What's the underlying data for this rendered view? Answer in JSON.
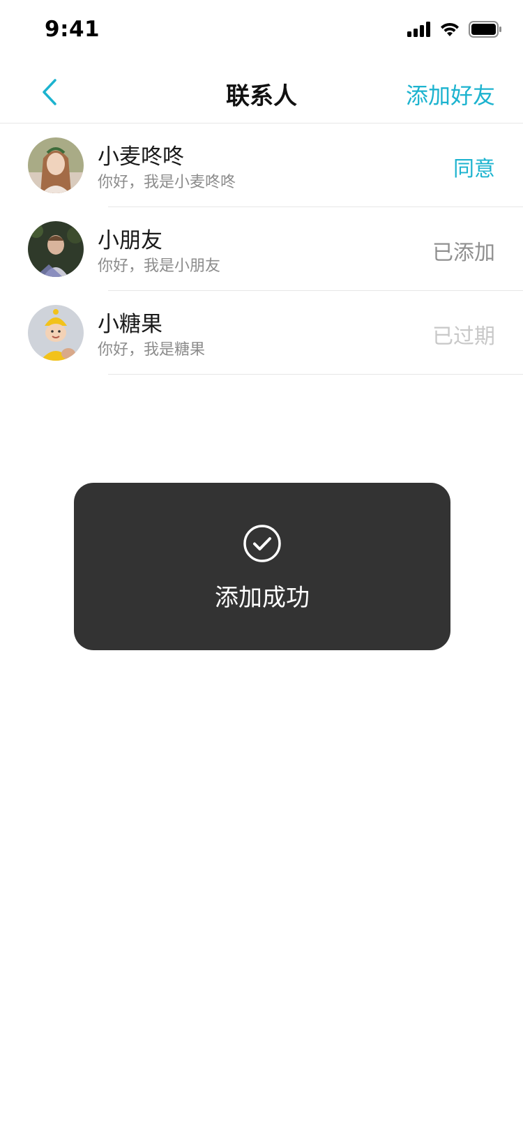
{
  "status_bar": {
    "time": "9:41"
  },
  "nav": {
    "title": "联系人",
    "right_action": "添加好友",
    "back_icon": "chevron-left-icon"
  },
  "colors": {
    "accent": "#1cb3cf",
    "toast_bg": "#333333",
    "added_text": "#8f8f8f",
    "expired_text": "#c8c8c8"
  },
  "contacts": [
    {
      "name": "小麦咚咚",
      "message": "你好，我是小麦咚咚",
      "action": "同意",
      "action_state": "accept"
    },
    {
      "name": "小朋友",
      "message": "你好，我是小朋友",
      "action": "已添加",
      "action_state": "added"
    },
    {
      "name": "小糖果",
      "message": "你好，我是糖果",
      "action": "已过期",
      "action_state": "expired"
    }
  ],
  "toast": {
    "icon": "check-circle-icon",
    "text": "添加成功"
  }
}
